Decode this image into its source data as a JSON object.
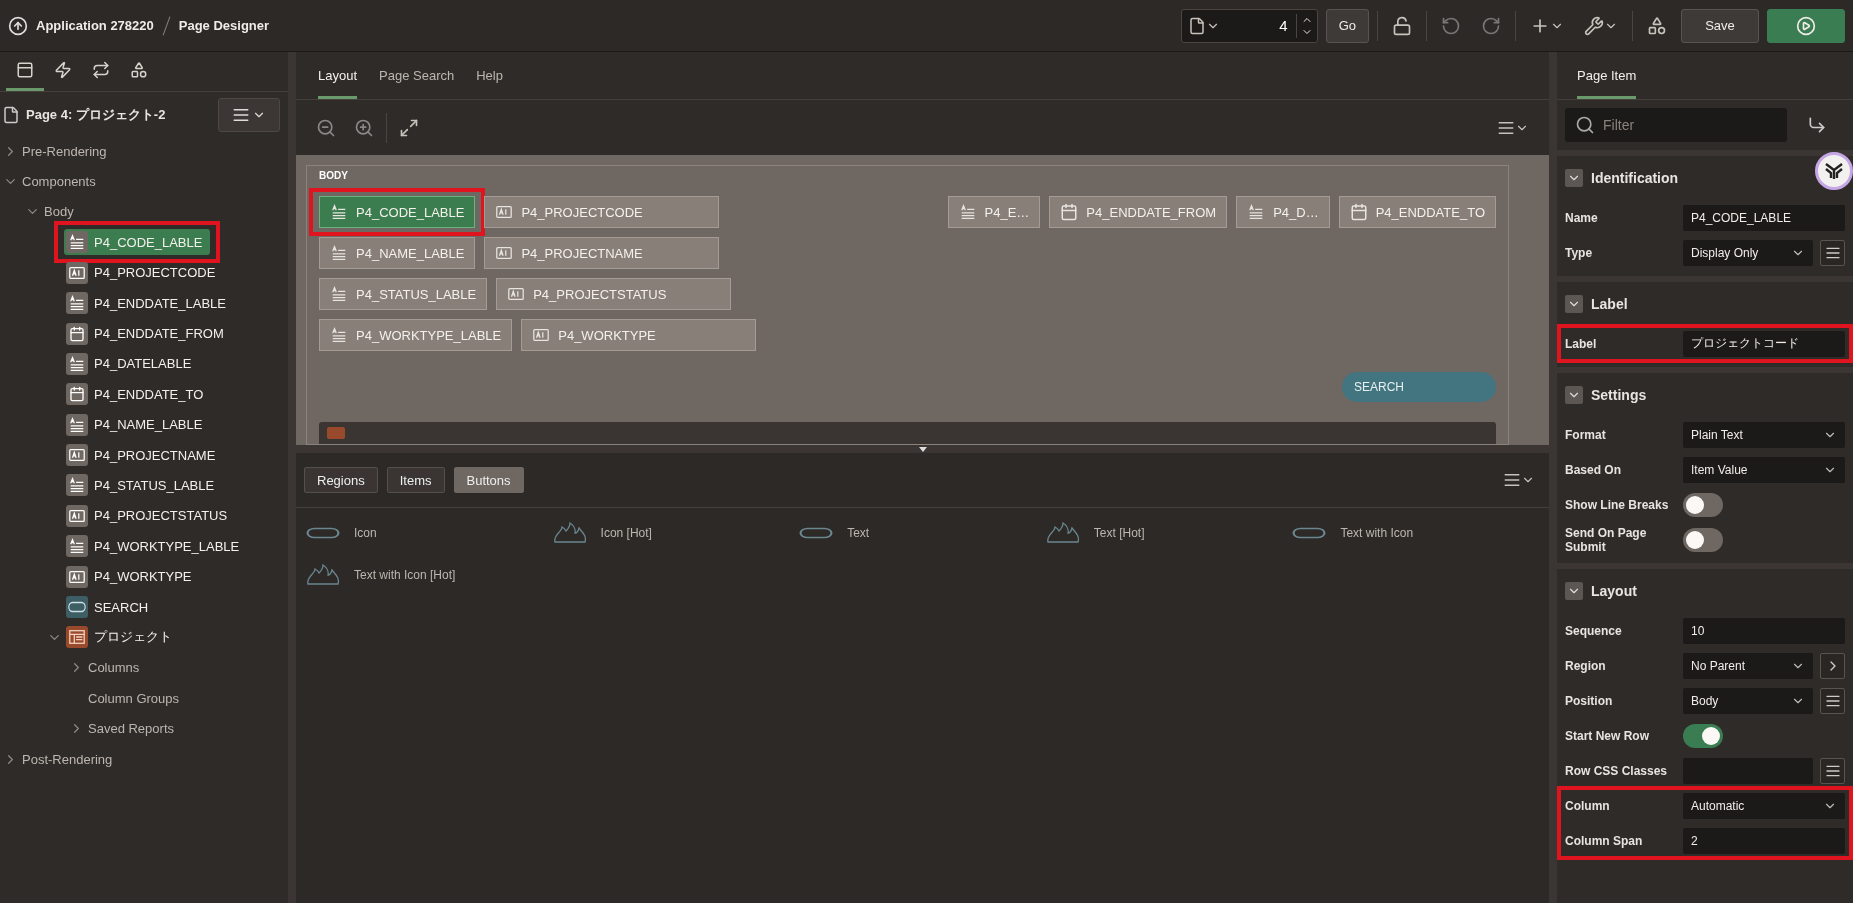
{
  "header": {
    "app": "Application 278220",
    "page": "Page Designer",
    "page_number": "4",
    "go": "Go",
    "save": "Save"
  },
  "left_tabs": [
    {
      "kind": "rendering",
      "selected": true
    },
    {
      "kind": "dynamic",
      "selected": false
    },
    {
      "kind": "processing",
      "selected": false
    },
    {
      "kind": "shared",
      "selected": false
    }
  ],
  "page_title": "Page 4: プロジェクト-2",
  "tree": [
    {
      "label": "Pre-Rendering",
      "expanded": false
    },
    {
      "label": "Components",
      "expanded": true,
      "children": [
        {
          "label": "Body",
          "expanded": true,
          "children": [
            {
              "label": "P4_CODE_LABLE",
              "kind": "label",
              "selected": true,
              "highlighted": true
            },
            {
              "label": "P4_PROJECTCODE",
              "kind": "text",
              "selected": false
            },
            {
              "label": "P4_ENDDATE_LABLE",
              "kind": "label",
              "selected": false
            },
            {
              "label": "P4_ENDDATE_FROM",
              "kind": "date",
              "selected": false
            },
            {
              "label": "P4_DATELABLE",
              "kind": "label",
              "selected": false
            },
            {
              "label": "P4_ENDDATE_TO",
              "kind": "date",
              "selected": false
            },
            {
              "label": "P4_NAME_LABLE",
              "kind": "label",
              "selected": false
            },
            {
              "label": "P4_PROJECTNAME",
              "kind": "text",
              "selected": false
            },
            {
              "label": "P4_STATUS_LABLE",
              "kind": "label",
              "selected": false
            },
            {
              "label": "P4_PROJECTSTATUS",
              "kind": "text",
              "selected": false
            },
            {
              "label": "P4_WORKTYPE_LABLE",
              "kind": "label",
              "selected": false
            },
            {
              "label": "P4_WORKTYPE",
              "kind": "text",
              "selected": false
            },
            {
              "label": "SEARCH",
              "kind": "button",
              "selected": false
            },
            {
              "label": "プロジェクト",
              "kind": "region",
              "selected": false,
              "expanded": true,
              "children": [
                {
                  "label": "Columns",
                  "expanded": false
                },
                {
                  "label": "Column Groups"
                },
                {
                  "label": "Saved Reports",
                  "expanded": false
                }
              ]
            }
          ]
        }
      ]
    },
    {
      "label": "Post-Rendering",
      "expanded": false
    }
  ],
  "center_tabs": [
    {
      "label": "Layout",
      "selected": true
    },
    {
      "label": "Page Search",
      "selected": false
    },
    {
      "label": "Help",
      "selected": false
    }
  ],
  "canvas": {
    "region_label": "BODY",
    "rows": [
      {
        "start": [
          {
            "label": "P4_CODE_LABLE",
            "kind": "label",
            "selected": true,
            "highlighted": true
          },
          {
            "label": "P4_PROJECTCODE",
            "kind": "text",
            "selected": false
          }
        ],
        "end": [
          {
            "label": "P4_E…",
            "kind": "label",
            "selected": false
          },
          {
            "label": "P4_ENDDATE_FROM",
            "kind": "date",
            "selected": false
          },
          {
            "label": "P4_D…",
            "kind": "label",
            "selected": false
          },
          {
            "label": "P4_ENDDATE_TO",
            "kind": "date",
            "selected": false
          }
        ]
      },
      {
        "start": [
          {
            "label": "P4_NAME_LABLE",
            "kind": "label",
            "selected": false
          },
          {
            "label": "P4_PROJECTNAME",
            "kind": "text",
            "selected": false
          }
        ]
      },
      {
        "start": [
          {
            "label": "P4_STATUS_LABLE",
            "kind": "label",
            "selected": false
          },
          {
            "label": "P4_PROJECTSTATUS",
            "kind": "text",
            "selected": false
          }
        ]
      },
      {
        "start": [
          {
            "label": "P4_WORKTYPE_LABLE",
            "kind": "label",
            "selected": false
          },
          {
            "label": "P4_WORKTYPE",
            "kind": "text",
            "selected": false
          }
        ]
      }
    ],
    "button": "SEARCH"
  },
  "gallery_tabs": [
    {
      "label": "Regions",
      "selected": false
    },
    {
      "label": "Items",
      "selected": false
    },
    {
      "label": "Buttons",
      "selected": true
    }
  ],
  "gallery_items": [
    {
      "label": "Icon",
      "kind": "pill"
    },
    {
      "label": "Icon [Hot]",
      "kind": "flame"
    },
    {
      "label": "Text",
      "kind": "pill"
    },
    {
      "label": "Text [Hot]",
      "kind": "flame"
    },
    {
      "label": "Text with Icon",
      "kind": "pill"
    },
    {
      "label": "Text with Icon [Hot]",
      "kind": "flame"
    }
  ],
  "right_tab": "Page Item",
  "filter": {
    "placeholder": "Filter"
  },
  "sections": [
    {
      "title": "Identification",
      "rows": [
        {
          "label": "Name",
          "kind": "text",
          "value": "P4_CODE_LABLE"
        },
        {
          "label": "Type",
          "kind": "select",
          "value": "Display Only",
          "extra": {
            "kind": "list"
          }
        }
      ]
    },
    {
      "title": "Label",
      "rows": [
        {
          "label": "Label",
          "kind": "text",
          "value": "プロジェクトコード",
          "highlighted": true
        }
      ]
    },
    {
      "title": "Settings",
      "rows": [
        {
          "label": "Format",
          "kind": "select",
          "value": "Plain Text"
        },
        {
          "label": "Based On",
          "kind": "select",
          "value": "Item Value"
        },
        {
          "label": "Show Line Breaks",
          "kind": "switch",
          "on": false
        },
        {
          "label": "Send On Page Submit",
          "kind": "switch",
          "on": false
        }
      ]
    },
    {
      "title": "Layout",
      "rows": [
        {
          "label": "Sequence",
          "kind": "text",
          "value": "10"
        },
        {
          "label": "Region",
          "kind": "select",
          "value": "No Parent",
          "extra": {
            "kind": "arrow"
          }
        },
        {
          "label": "Position",
          "kind": "select",
          "value": "Body",
          "extra": {
            "kind": "list"
          }
        },
        {
          "label": "Start New Row",
          "kind": "switch",
          "on": true
        },
        {
          "label": "Row CSS Classes",
          "kind": "text",
          "extra": {
            "kind": "list"
          }
        },
        {
          "label": "Column",
          "kind": "select",
          "value": "Automatic",
          "highlighted": true
        },
        {
          "label": "Column Span",
          "kind": "text",
          "value": "2",
          "highlighted": true
        }
      ]
    }
  ]
}
